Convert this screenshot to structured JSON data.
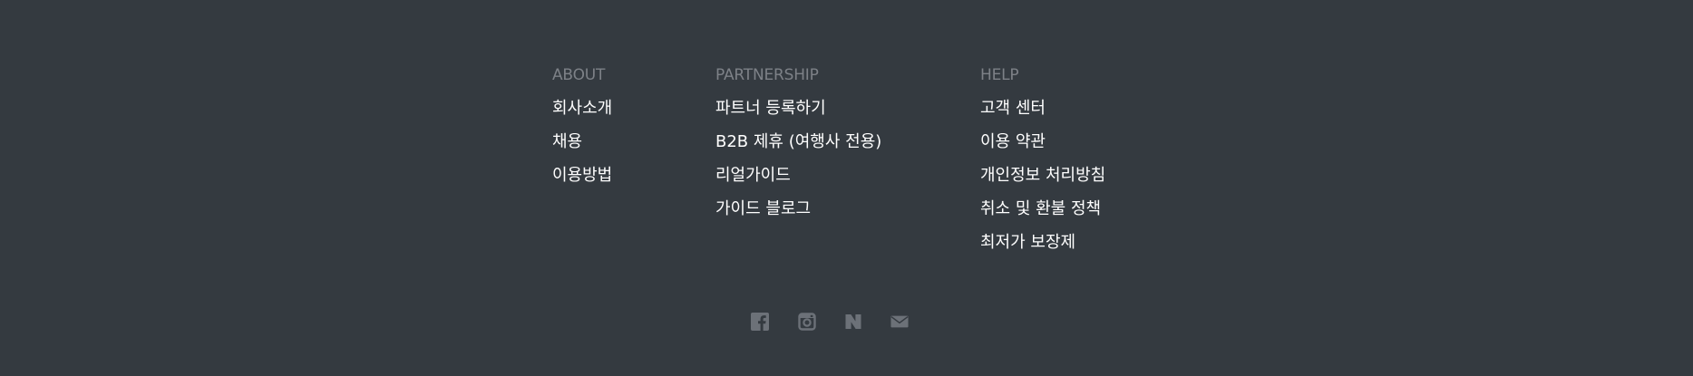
{
  "footer": {
    "columns": [
      {
        "title": "ABOUT",
        "links": [
          "회사소개",
          "채용",
          "이용방법"
        ]
      },
      {
        "title": "PARTNERSHIP",
        "links": [
          "파트너 등록하기",
          "B2B 제휴 (여행사 전용)",
          "리얼가이드",
          "가이드 블로그"
        ]
      },
      {
        "title": "HELP",
        "links": [
          "고객 센터",
          "이용 약관",
          "개인정보 처리방침",
          "취소 및 환불 정책",
          "최저가 보장제"
        ]
      }
    ],
    "social": [
      {
        "icon": "facebook-icon"
      },
      {
        "icon": "instagram-icon"
      },
      {
        "icon": "naver-blog-icon"
      },
      {
        "icon": "mail-icon"
      }
    ],
    "colors": {
      "background": "#343a40",
      "heading": "#7d8187",
      "link": "#ffffff",
      "icon": "#6c7178"
    }
  }
}
